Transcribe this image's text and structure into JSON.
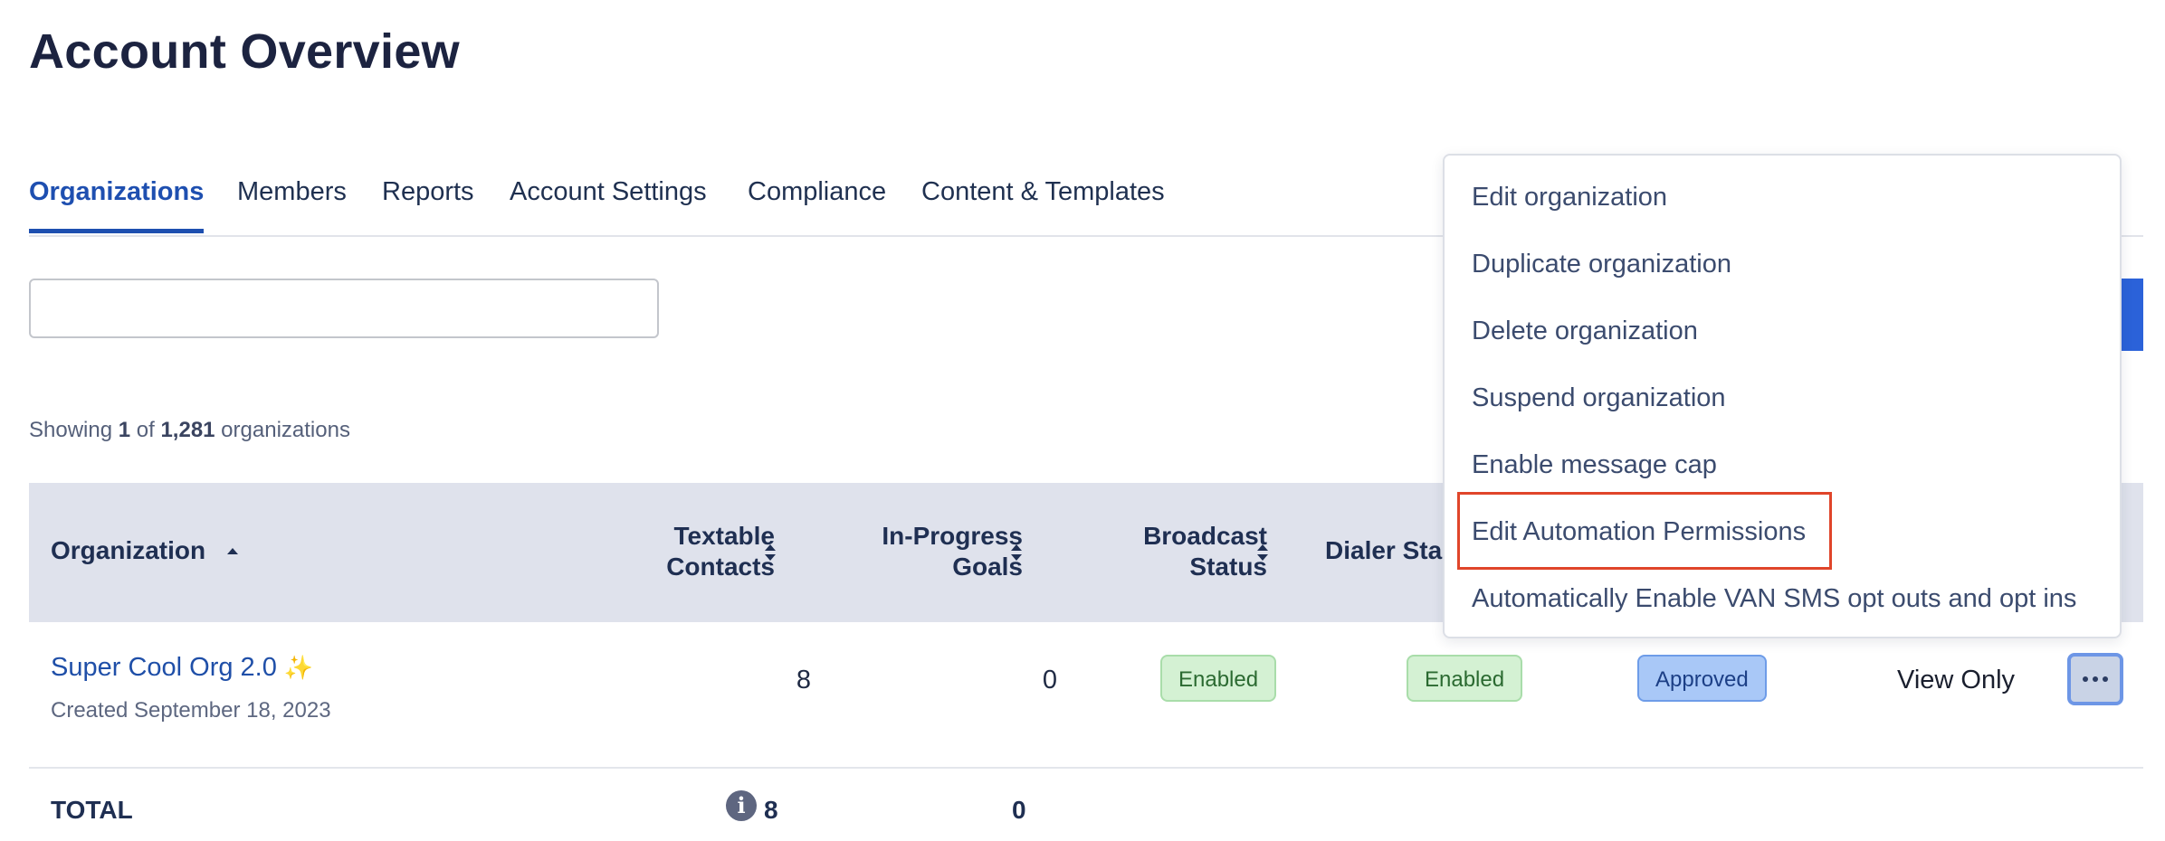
{
  "page": {
    "title": "Account Overview"
  },
  "tabs": [
    {
      "label": "Organizations",
      "active": true
    },
    {
      "label": "Members"
    },
    {
      "label": "Reports"
    },
    {
      "label": "Account Settings"
    },
    {
      "label": "Compliance"
    },
    {
      "label": "Content & Templates"
    }
  ],
  "search": {
    "value": "",
    "placeholder": ""
  },
  "summary": {
    "prefix": "Showing ",
    "shown": "1",
    "middle": " of ",
    "total": "1,281",
    "suffix": " organizations"
  },
  "table": {
    "headers": {
      "organization": "Organization",
      "textable_line1": "Textable",
      "textable_line2": "Contacts",
      "inprogress_line1": "In-Progress",
      "inprogress_line2": "Goals",
      "broadcast_line1": "Broadcast",
      "broadcast_line2": "Status",
      "dialer": "Dialer Sta"
    },
    "rows": [
      {
        "name": "Super Cool Org 2.0",
        "sparkle": "✨",
        "created": "Created September 18, 2023",
        "textable_contacts": "8",
        "in_progress_goals": "0",
        "broadcast_status": "Enabled",
        "dialer_status": "Enabled",
        "approval": "Approved",
        "access": "View Only"
      }
    ],
    "total": {
      "label": "TOTAL",
      "textable_contacts": "8",
      "in_progress_goals": "0"
    }
  },
  "menu": {
    "items": [
      "Edit organization",
      "Duplicate organization",
      "Delete organization",
      "Suspend organization",
      "Enable message cap",
      "Edit Automation Permissions",
      "Automatically Enable VAN SMS opt outs and opt ins"
    ],
    "highlighted_index": 5
  },
  "colors": {
    "accent": "#1e4fb0",
    "header_bg": "#dfe2ec",
    "enabled_badge": "#d4f1d3",
    "approved_badge": "#a9c8f7",
    "highlight_outline": "#e0452a"
  },
  "icons": {
    "sort_asc": "caret-up-icon",
    "sort_both": "sort-icon",
    "info": "info-icon",
    "more": "ellipsis-icon",
    "sparkle": "sparkles-icon"
  }
}
